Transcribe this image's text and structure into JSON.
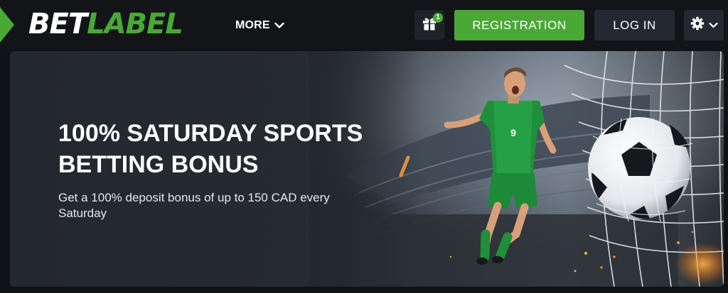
{
  "header": {
    "logo": {
      "part1": "BET",
      "part2": "LABEL"
    },
    "more_label": "MORE",
    "gift_badge_count": "1",
    "register_label": "REGISTRATION",
    "login_label": "LOG IN"
  },
  "promo": {
    "title_line1": "100% SATURDAY SPORTS",
    "title_line2": "BETTING BONUS",
    "subtitle_line1": "Get a 100% deposit bonus of up to 150 CAD every",
    "subtitle_line2": "Saturday",
    "player_number": "9"
  },
  "icons": {
    "more": "chevron-down-icon",
    "gift": "gift-icon",
    "settings": "gear-icon",
    "settings_caret": "chevron-down-icon"
  },
  "colors": {
    "brand_green": "#49a934",
    "header_bg": "#121418",
    "button_dark": "#232831",
    "banner_bg": "#23272e"
  }
}
